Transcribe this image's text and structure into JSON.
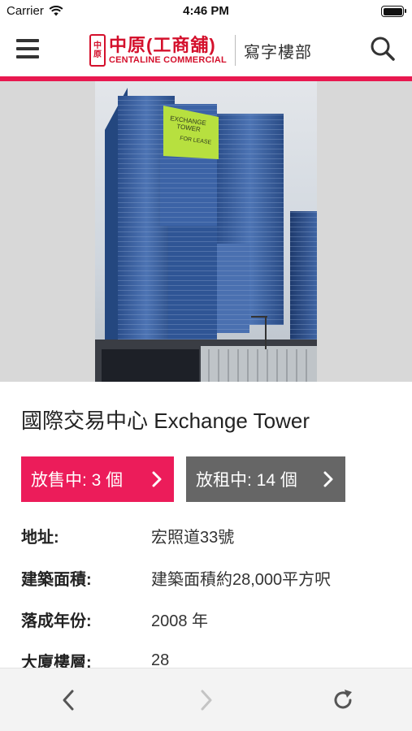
{
  "status_bar": {
    "carrier": "Carrier",
    "time": "4:46 PM",
    "battery_level": 1.0
  },
  "header": {
    "logo_seal": "中原",
    "logo_chinese": "中原(工商舖)",
    "logo_english": "CENTALINE COMMERCIAL",
    "section": "寫字樓部",
    "accent_color": "#e8184f",
    "menu_icon": "hamburger-menu-icon",
    "search_icon": "search-icon"
  },
  "hero": {
    "image_name": "exchange-tower-photo",
    "sign_text": [
      "EXCHANGE",
      "TOWER",
      "FOR LEASE"
    ]
  },
  "building": {
    "title": "國際交易中心 Exchange Tower"
  },
  "actions": {
    "sale_label": "放售中: 3 個",
    "sale_color": "#ec1c5a",
    "rent_label": "放租中: 14 個",
    "rent_color": "#666666"
  },
  "details": [
    {
      "label": "地址:",
      "value": "宏照道33號"
    },
    {
      "label": "建築面積:",
      "value": "建築面積約28,000平方呎"
    },
    {
      "label": "落成年份:",
      "value": "2008 年"
    },
    {
      "label": "大廈樓層:",
      "value": "28"
    }
  ],
  "toolbar": {
    "back_icon": "chevron-left-icon",
    "forward_icon": "chevron-right-icon",
    "reload_icon": "reload-icon"
  }
}
